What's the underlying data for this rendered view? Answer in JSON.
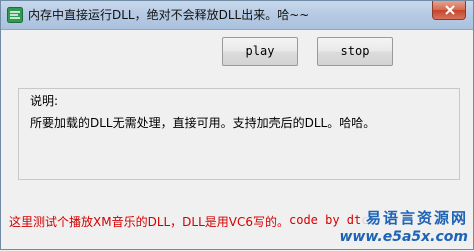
{
  "window": {
    "title": "内存中直接运行DLL，绝对不会释放DLL出来。哈~~"
  },
  "toolbar": {
    "play_label": "play",
    "stop_label": "stop"
  },
  "group": {
    "label": "说明:",
    "content": "所要加载的DLL无需处理，直接可用。支持加壳后的DLL。哈哈。"
  },
  "footer": {
    "note": "这里测试个播放XM音乐的DLL，DLL是用VC6写的。",
    "credit": "code by dtcs"
  },
  "watermark": {
    "line1": "易语言资源网",
    "line2": "www.e5a5x.com"
  },
  "colors": {
    "footer_text": "#d40000",
    "watermark": "#1d63b6",
    "window_bg": "#f0f0f0"
  }
}
